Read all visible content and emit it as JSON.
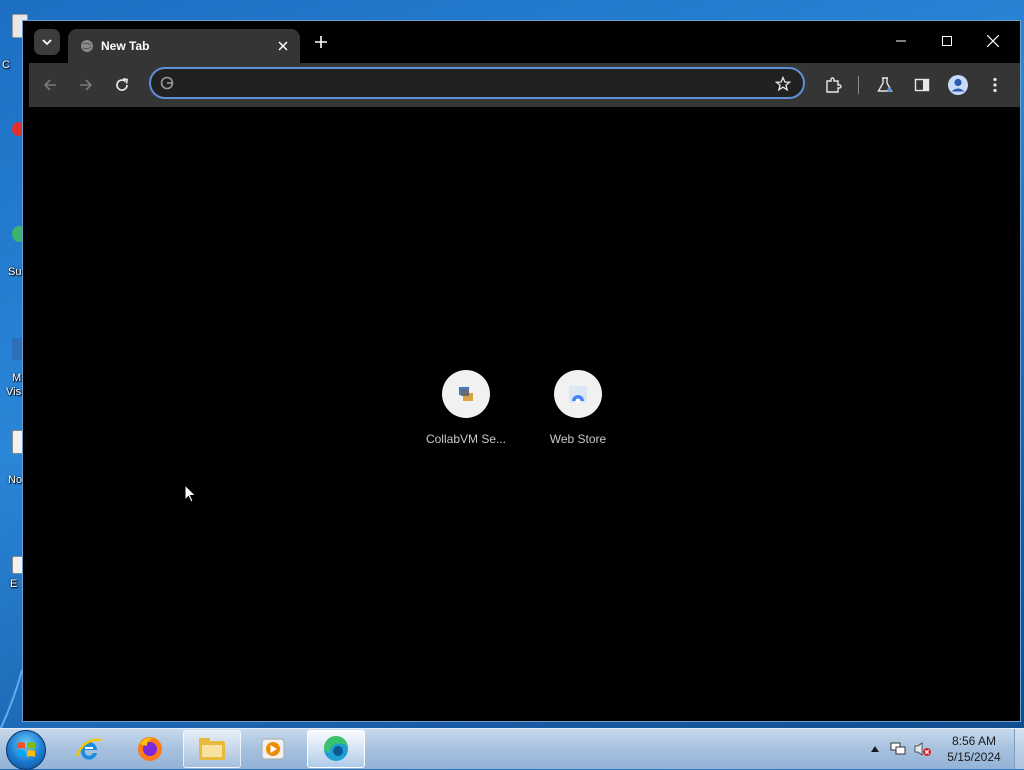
{
  "desktop": {
    "icon_labels": [
      "C",
      "Su",
      "M",
      "Vis",
      "No",
      "E"
    ]
  },
  "browser": {
    "tab": {
      "title": "New Tab"
    },
    "omnibox": {
      "value": "",
      "placeholder": ""
    },
    "shortcuts": [
      {
        "label": "CollabVM Se..."
      },
      {
        "label": "Web Store"
      }
    ]
  },
  "taskbar": {
    "clock": {
      "time": "8:56 AM",
      "date": "5/15/2024"
    },
    "apps": [
      "internet-explorer",
      "firefox",
      "file-explorer",
      "media-player",
      "edge"
    ]
  },
  "colors": {
    "accent": "#5f8fd6",
    "titlebar": "#000000",
    "toolbar": "#353535",
    "taskbar": "#a9c3df"
  }
}
